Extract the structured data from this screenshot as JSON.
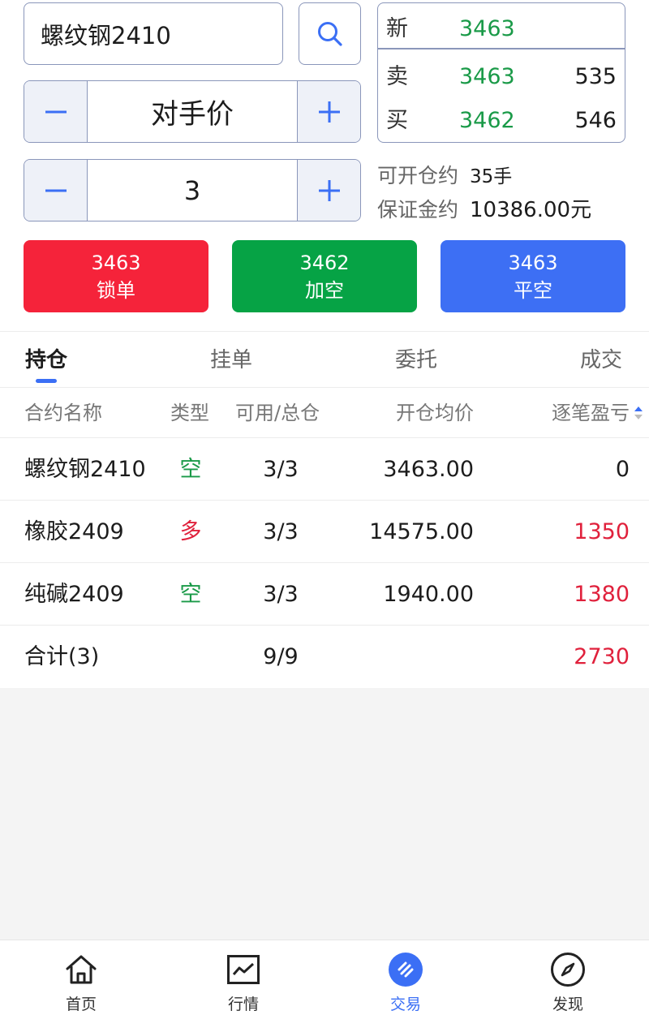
{
  "search": {
    "value": "螺纹钢2410"
  },
  "price_type": {
    "value": "对手价"
  },
  "quantity": {
    "value": "3"
  },
  "quote": {
    "last_label": "新",
    "last_price": "3463",
    "ask_label": "卖",
    "ask_price": "3463",
    "ask_volume": "535",
    "bid_label": "买",
    "bid_price": "3462",
    "bid_volume": "546"
  },
  "info": {
    "openable_label": "可开仓约",
    "openable_value": "35手",
    "margin_label": "保证金约",
    "margin_value": "10386.00元"
  },
  "actions": [
    {
      "price": "3463",
      "label": "锁单",
      "color": "#f5233a"
    },
    {
      "price": "3462",
      "label": "加空",
      "color": "#06a345"
    },
    {
      "price": "3463",
      "label": "平空",
      "color": "#3d6ff4"
    }
  ],
  "tabs": [
    "持仓",
    "挂单",
    "委托",
    "成交"
  ],
  "table": {
    "headers": [
      "合约名称",
      "类型",
      "可用/总仓",
      "开仓均价",
      "逐笔盈亏"
    ],
    "rows": [
      {
        "name": "螺纹钢2410",
        "type": "空",
        "avail": "3/3",
        "price": "3463.00",
        "pnl": "0"
      },
      {
        "name": "橡胶2409",
        "type": "多",
        "avail": "3/3",
        "price": "14575.00",
        "pnl": "1350"
      },
      {
        "name": "纯碱2409",
        "type": "空",
        "avail": "3/3",
        "price": "1940.00",
        "pnl": "1380"
      }
    ],
    "total": {
      "label": "合计(3)",
      "avail": "9/9",
      "pnl": "2730"
    }
  },
  "nav": [
    {
      "label": "首页",
      "icon": "home-icon"
    },
    {
      "label": "行情",
      "icon": "chart-icon"
    },
    {
      "label": "交易",
      "icon": "trade-icon"
    },
    {
      "label": "发现",
      "icon": "compass-icon"
    }
  ],
  "colors": {
    "accent": "#3b6ff5",
    "up": "#e0213c",
    "down": "#1a9a48"
  }
}
